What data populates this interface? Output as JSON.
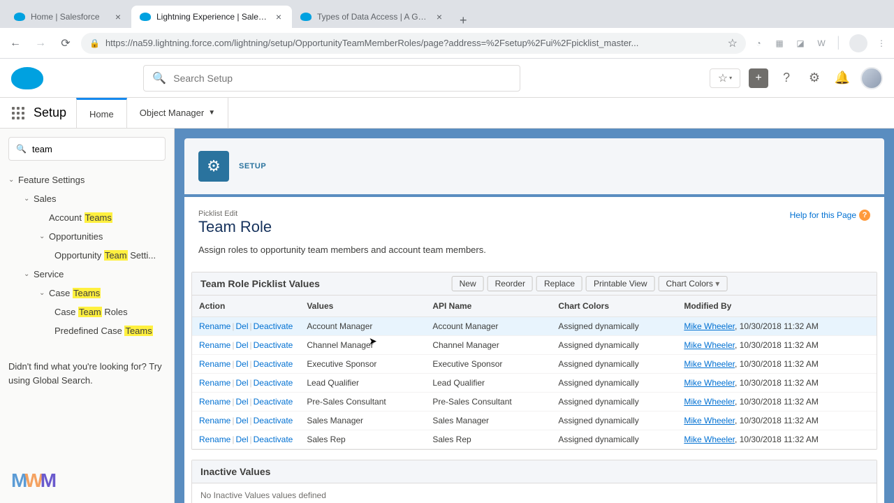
{
  "browser": {
    "tabs": [
      {
        "title": "Home | Salesforce",
        "active": false
      },
      {
        "title": "Lightning Experience | Salesfo",
        "active": true
      },
      {
        "title": "Types of Data Access | A Guide",
        "active": false
      }
    ],
    "url": "https://na59.lightning.force.com/lightning/setup/OpportunityTeamMemberRoles/page?address=%2Fsetup%2Fui%2Fpicklist_master..."
  },
  "sf": {
    "search_placeholder": "Search Setup",
    "nav_title": "Setup",
    "nav_home": "Home",
    "nav_obj": "Object Manager"
  },
  "sidebar": {
    "search_value": "team",
    "feature_settings": "Feature Settings",
    "sales": "Sales",
    "account_pre": "Account ",
    "account_hl": "Teams",
    "opportunities": "Opportunities",
    "opp_pre": "Opportunity ",
    "opp_hl": "Team",
    "opp_post": " Setti...",
    "service": "Service",
    "case_pre": "Case ",
    "case_hl": "Teams",
    "caserole_pre": "Case ",
    "caserole_hl": "Team",
    "caserole_post": " Roles",
    "predef_pre": "Predefined Case ",
    "predef_hl": "Teams",
    "footer": "Didn't find what you're looking for? Try using Global Search."
  },
  "setup": {
    "label": "SETUP",
    "picklist_edit": "Picklist Edit",
    "title": "Team Role",
    "help": "Help for this Page",
    "desc": "Assign roles to opportunity team members and account team members.",
    "panel_title": "Team Role Picklist Values",
    "btn_new": "New",
    "btn_reorder": "Reorder",
    "btn_replace": "Replace",
    "btn_print": "Printable View",
    "btn_chart": "Chart Colors",
    "col_action": "Action",
    "col_values": "Values",
    "col_api": "API Name",
    "col_chart": "Chart Colors",
    "col_mod": "Modified By",
    "act_rename": "Rename",
    "act_del": "Del",
    "act_deact": "Deactivate",
    "rows": [
      {
        "value": "Account Manager",
        "api": "Account Manager",
        "chart": "Assigned dynamically",
        "by": "Mike Wheeler",
        "when": ", 10/30/2018 11:32 AM"
      },
      {
        "value": "Channel Manager",
        "api": "Channel Manager",
        "chart": "Assigned dynamically",
        "by": "Mike Wheeler",
        "when": ", 10/30/2018 11:32 AM"
      },
      {
        "value": "Executive Sponsor",
        "api": "Executive Sponsor",
        "chart": "Assigned dynamically",
        "by": "Mike Wheeler",
        "when": ", 10/30/2018 11:32 AM"
      },
      {
        "value": "Lead Qualifier",
        "api": "Lead Qualifier",
        "chart": "Assigned dynamically",
        "by": "Mike Wheeler",
        "when": ", 10/30/2018 11:32 AM"
      },
      {
        "value": "Pre-Sales Consultant",
        "api": "Pre-Sales Consultant",
        "chart": "Assigned dynamically",
        "by": "Mike Wheeler",
        "when": ", 10/30/2018 11:32 AM"
      },
      {
        "value": "Sales Manager",
        "api": "Sales Manager",
        "chart": "Assigned dynamically",
        "by": "Mike Wheeler",
        "when": ", 10/30/2018 11:32 AM"
      },
      {
        "value": "Sales Rep",
        "api": "Sales Rep",
        "chart": "Assigned dynamically",
        "by": "Mike Wheeler",
        "when": ", 10/30/2018 11:32 AM"
      }
    ],
    "inactive_title": "Inactive Values",
    "inactive_body": "No Inactive Values values defined"
  }
}
